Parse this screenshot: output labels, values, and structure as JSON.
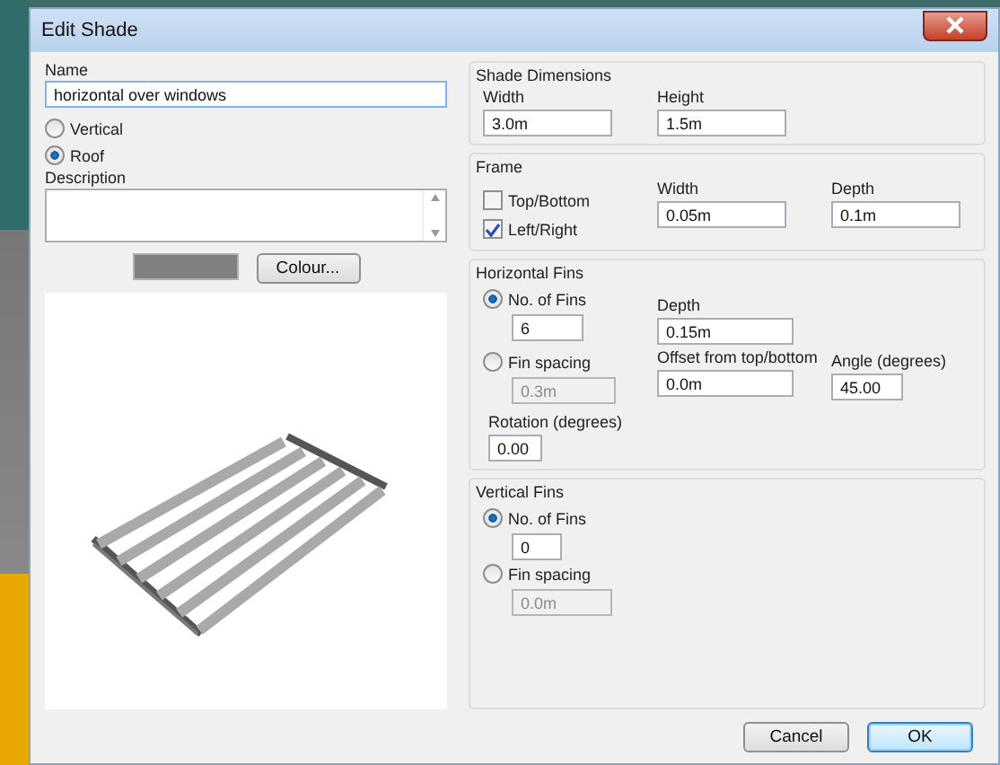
{
  "window": {
    "title": "Edit Shade"
  },
  "name": {
    "label": "Name",
    "value": "horizontal over windows"
  },
  "orientation": [
    {
      "label": "Vertical",
      "selected": false
    },
    {
      "label": "Roof",
      "selected": true
    }
  ],
  "description": {
    "label": "Description"
  },
  "colour_button": "Colour...",
  "shade_dimensions": {
    "title": "Shade Dimensions",
    "fields": [
      {
        "label": "Width",
        "value": "3.0m"
      },
      {
        "label": "Height",
        "value": "1.5m"
      }
    ]
  },
  "frame": {
    "title": "Frame",
    "checks": [
      {
        "label": "Top/Bottom",
        "checked": false
      },
      {
        "label": "Left/Right",
        "checked": true
      }
    ],
    "fields": [
      {
        "label": "Width",
        "value": "0.05m"
      },
      {
        "label": "Depth",
        "value": "0.1m"
      }
    ]
  },
  "horizontal_fins": {
    "title": "Horizontal Fins",
    "modes": [
      {
        "label": "No. of Fins",
        "selected": true,
        "value": "6"
      },
      {
        "label": "Fin spacing",
        "selected": false,
        "value": "0.3m"
      }
    ],
    "depth": {
      "label": "Depth",
      "value": "0.15m"
    },
    "offset": {
      "label": "Offset from top/bottom",
      "value": "0.0m"
    },
    "angle": {
      "label": "Angle (degrees)",
      "value": "45.00"
    },
    "rotation": {
      "label": "Rotation (degrees)",
      "value": "0.00"
    }
  },
  "vertical_fins": {
    "title": "Vertical Fins",
    "modes": [
      {
        "label": "No. of Fins",
        "selected": true,
        "value": "0"
      },
      {
        "label": "Fin spacing",
        "selected": false,
        "value": "0.0m"
      }
    ]
  },
  "buttons": [
    {
      "label": "Cancel",
      "default": false
    },
    {
      "label": "OK",
      "default": true
    }
  ]
}
